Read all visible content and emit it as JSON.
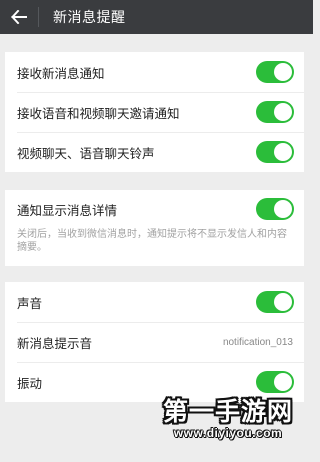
{
  "header": {
    "title": "新消息提醒",
    "back_icon": "back-arrow-icon"
  },
  "section1": {
    "items": [
      {
        "label": "接收新消息通知",
        "enabled": true
      },
      {
        "label": "接收语音和视频聊天邀请通知",
        "enabled": true
      },
      {
        "label": "视频聊天、语音聊天铃声",
        "enabled": true
      }
    ]
  },
  "section2": {
    "label": "通知显示消息详情",
    "enabled": true,
    "description": "关闭后，当收到微信消息时，通知提示将不显示发信人和内容摘要。"
  },
  "section3": {
    "sound_label": "声音",
    "sound_enabled": true,
    "tone_label": "新消息提示音",
    "tone_value": "notification_013",
    "vibrate_label": "振动",
    "vibrate_enabled": true
  },
  "watermark": {
    "brand": "第一手游网",
    "url": "www.diyiyou.com"
  },
  "colors": {
    "toolbar": "#3a3c3f",
    "toggle_on": "#2bbd3a",
    "background": "#ededed"
  }
}
